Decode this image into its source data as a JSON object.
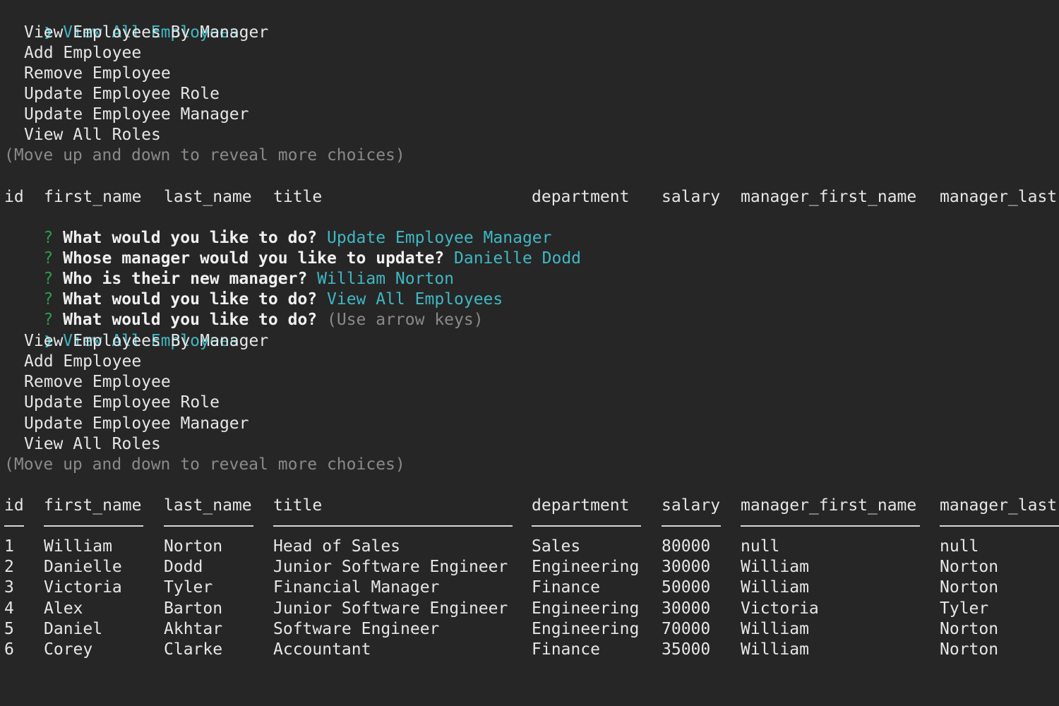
{
  "menu_top": {
    "selected": "View All Employees",
    "options": [
      "View Employees By Manager",
      "Add Employee",
      "Remove Employee",
      "Update Employee Role",
      "Update Employee Manager",
      "View All Roles"
    ],
    "hint": "(Move up and down to reveal more choices)"
  },
  "header_top": [
    "id",
    "first_name",
    "last_name",
    "title",
    "department",
    "salary",
    "manager_first_name",
    "manager_last"
  ],
  "prompts": [
    {
      "q": "What would you like to do?",
      "a": "Update Employee Manager"
    },
    {
      "q": "Whose manager would you like to update?",
      "a": "Danielle Dodd"
    },
    {
      "q": "Who is their new manager?",
      "a": "William Norton"
    },
    {
      "q": "What would you like to do?",
      "a": "View All Employees"
    },
    {
      "q": "What would you like to do?",
      "a": "(Use arrow keys)"
    }
  ],
  "symbols": {
    "cursor": "❯",
    "question": "?"
  },
  "menu_bottom": {
    "selected": "View All Employees",
    "options": [
      "View Employees By Manager",
      "Add Employee",
      "Remove Employee",
      "Update Employee Role",
      "Update Employee Manager",
      "View All Roles"
    ],
    "hint": "(Move up and down to reveal more choices)"
  },
  "table": {
    "headers": [
      "id",
      "first_name",
      "last_name",
      "title",
      "department",
      "salary",
      "manager_first_name",
      "manager_last"
    ],
    "rows": [
      [
        "1",
        "William",
        "Norton",
        "Head of Sales",
        "Sales",
        "80000",
        "null",
        "null"
      ],
      [
        "2",
        "Danielle",
        "Dodd",
        "Junior Software Engineer",
        "Engineering",
        "30000",
        "William",
        "Norton"
      ],
      [
        "3",
        "Victoria",
        "Tyler",
        "Financial Manager",
        "Finance",
        "50000",
        "William",
        "Norton"
      ],
      [
        "4",
        "Alex",
        "Barton",
        "Junior Software Engineer",
        "Engineering",
        "30000",
        "Victoria",
        "Tyler"
      ],
      [
        "5",
        "Daniel",
        "Akhtar",
        "Software Engineer",
        "Engineering",
        "70000",
        "William",
        "Norton"
      ],
      [
        "6",
        "Corey",
        "Clarke",
        "Accountant",
        "Finance",
        "35000",
        "William",
        "Norton"
      ]
    ]
  },
  "colors": {
    "background": "#262626",
    "accent": "#3fb8c4",
    "question": "#2e9c4a",
    "hint": "#8a8a8a"
  }
}
